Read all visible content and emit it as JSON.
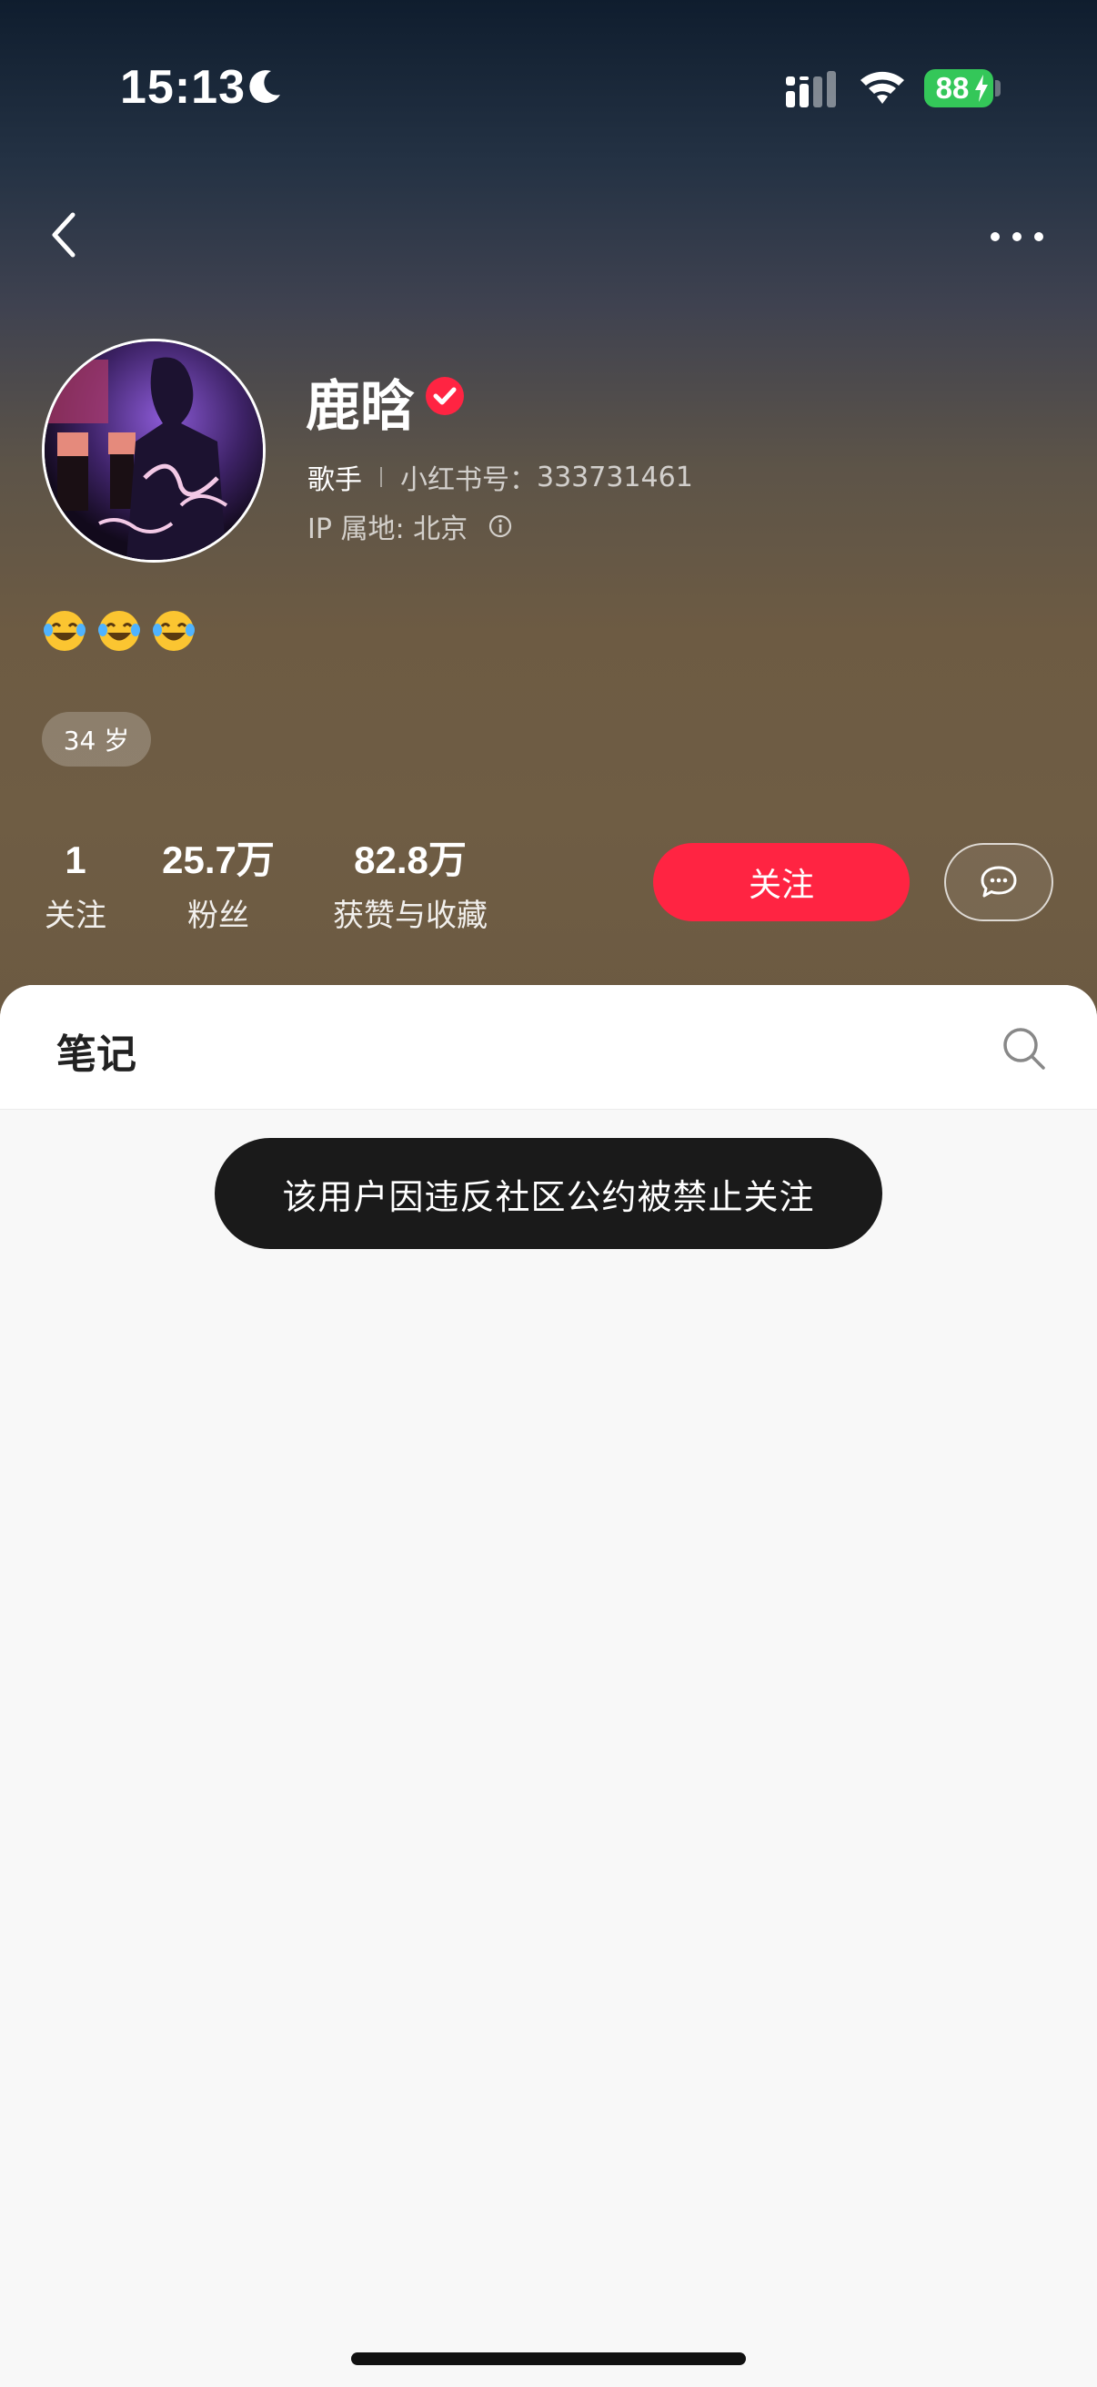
{
  "status_bar": {
    "time": "15:13",
    "battery": "88",
    "battery_color": "#34c759"
  },
  "profile": {
    "name": "鹿晗",
    "verified": true,
    "occupation": "歌手",
    "id_label": "小红书号：",
    "id_value": "333731461",
    "ip_location": "IP 属地: 北京",
    "bio_emojis": [
      "😂",
      "😂",
      "😂"
    ],
    "age_tag": "34 岁"
  },
  "stats": [
    {
      "value": "1",
      "label": "关注"
    },
    {
      "value": "25.7万",
      "label": "粉丝"
    },
    {
      "value": "82.8万",
      "label": "获赞与收藏"
    }
  ],
  "actions": {
    "follow_label": "关注",
    "follow_color": "#ff2442",
    "message_icon": "chat-bubble-icon"
  },
  "tabs": {
    "notes_label": "笔记"
  },
  "toast": {
    "text": "该用户因违反社区公约被禁止关注"
  },
  "icons": [
    "back-arrow-icon",
    "more-icon",
    "moon-icon",
    "signal-icon",
    "wifi-icon",
    "verified-icon",
    "info-icon",
    "search-icon"
  ]
}
